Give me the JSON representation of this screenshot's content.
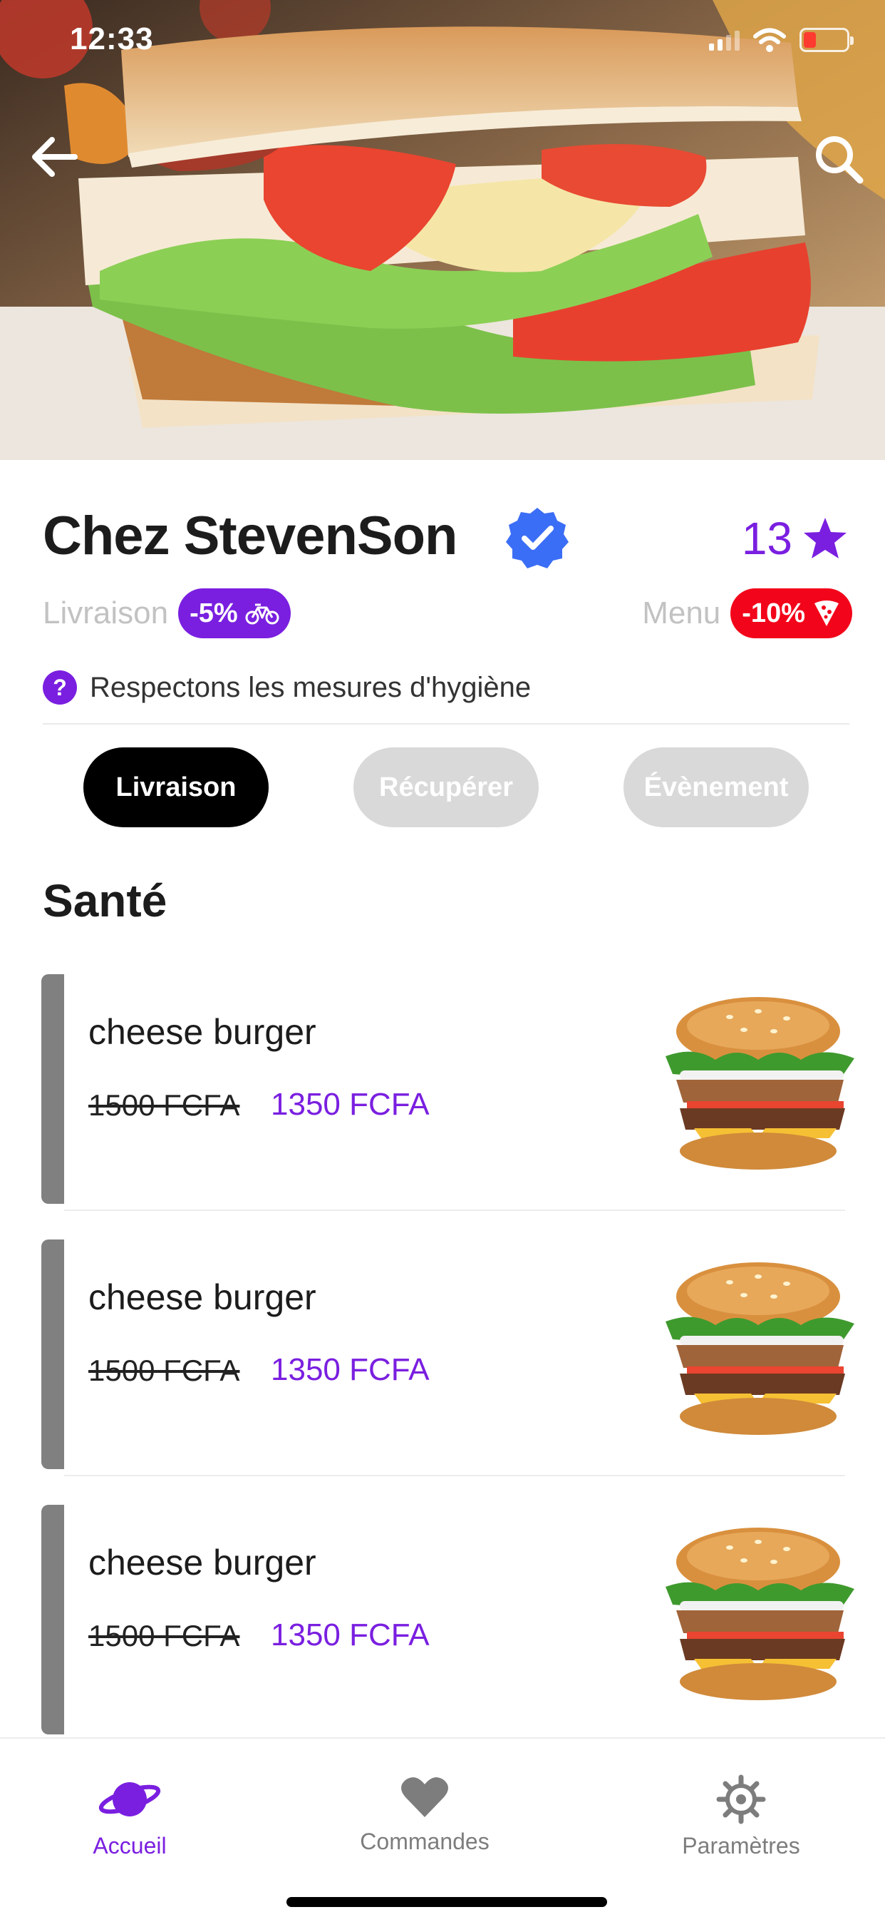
{
  "status_bar": {
    "time": "12:33",
    "icons": [
      "signal-icon",
      "wifi-icon",
      "battery-icon"
    ],
    "battery_color": "#ff3b30"
  },
  "header": {
    "back_icon": "arrow-left-icon",
    "search_icon": "search-icon",
    "hero_image": "club sandwich photo"
  },
  "restaurant": {
    "name": "Chez StevenSon",
    "verified_icon": "verified-badge-icon",
    "rating": "13",
    "rating_icon": "star-icon",
    "hygiene_text": "Respectons les mesures d'hygiène",
    "hygiene_icon": "help-icon",
    "hygiene_icon_glyph": "?"
  },
  "promos": {
    "delivery": {
      "label": "Livraison",
      "discount": "-5%",
      "icon": "bicycle-icon",
      "color": "#7a1fe0"
    },
    "menu": {
      "label": "Menu",
      "discount": "-10%",
      "icon": "pizza-icon",
      "color": "#f2051a"
    }
  },
  "tabs": [
    {
      "label": "Livraison",
      "active": true
    },
    {
      "label": "Récupérer",
      "active": false
    },
    {
      "label": "Évènement",
      "active": false
    }
  ],
  "section": {
    "title": "Santé"
  },
  "menu_items": [
    {
      "name": "cheese burger",
      "old_price": "1500 FCFA",
      "new_price": "1350 FCFA",
      "image": "burger-image"
    },
    {
      "name": "cheese burger",
      "old_price": "1500 FCFA",
      "new_price": "1350 FCFA",
      "image": "burger-image"
    },
    {
      "name": "cheese burger",
      "old_price": "1500 FCFA",
      "new_price": "1350 FCFA",
      "image": "burger-image"
    }
  ],
  "bottom_nav": [
    {
      "label": "Accueil",
      "icon": "planet-icon",
      "active": true
    },
    {
      "label": "Commandes",
      "icon": "heart-icon",
      "active": false
    },
    {
      "label": "Paramètres",
      "icon": "gear-icon",
      "active": false
    }
  ],
  "colors": {
    "accent": "#7a1fe0",
    "discount_red": "#f2051a",
    "tab_active": "#000000",
    "tab_inactive": "#d9d9d9",
    "item_bar": "#808080"
  }
}
